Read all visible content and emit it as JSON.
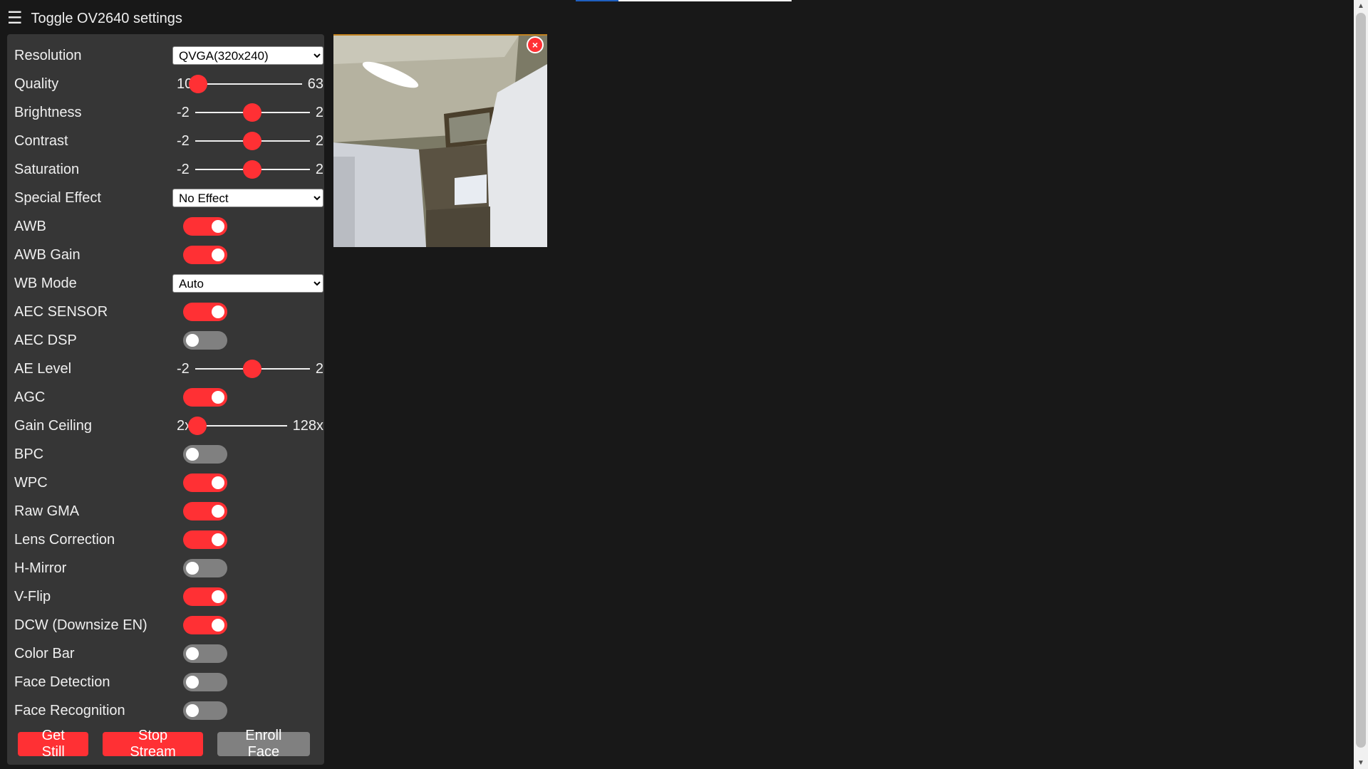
{
  "header": {
    "menu_icon": "☰",
    "title": "Toggle OV2640 settings"
  },
  "controls": {
    "resolution": {
      "label": "Resolution",
      "value": "QVGA(320x240)"
    },
    "quality": {
      "label": "Quality",
      "min": "10",
      "max": "63",
      "value": 10
    },
    "brightness": {
      "label": "Brightness",
      "min": "-2",
      "max": "2",
      "value": 0
    },
    "contrast": {
      "label": "Contrast",
      "min": "-2",
      "max": "2",
      "value": 0
    },
    "saturation": {
      "label": "Saturation",
      "min": "-2",
      "max": "2",
      "value": 0
    },
    "special_effect": {
      "label": "Special Effect",
      "value": "No Effect"
    },
    "awb": {
      "label": "AWB",
      "on": true
    },
    "awb_gain": {
      "label": "AWB Gain",
      "on": true
    },
    "wb_mode": {
      "label": "WB Mode",
      "value": "Auto"
    },
    "aec_sensor": {
      "label": "AEC SENSOR",
      "on": true
    },
    "aec_dsp": {
      "label": "AEC DSP",
      "on": false
    },
    "ae_level": {
      "label": "AE Level",
      "min": "-2",
      "max": "2",
      "value": 0
    },
    "agc": {
      "label": "AGC",
      "on": true
    },
    "gain_ceiling": {
      "label": "Gain Ceiling",
      "min": "2x",
      "max": "128x",
      "value_fraction": 0
    },
    "bpc": {
      "label": "BPC",
      "on": false
    },
    "wpc": {
      "label": "WPC",
      "on": true
    },
    "raw_gma": {
      "label": "Raw GMA",
      "on": true
    },
    "lens_correction": {
      "label": "Lens Correction",
      "on": true
    },
    "h_mirror": {
      "label": "H-Mirror",
      "on": false
    },
    "v_flip": {
      "label": "V-Flip",
      "on": true
    },
    "dcw": {
      "label": "DCW (Downsize EN)",
      "on": true
    },
    "color_bar": {
      "label": "Color Bar",
      "on": false
    },
    "face_detection": {
      "label": "Face Detection",
      "on": false
    },
    "face_recognition": {
      "label": "Face Recognition",
      "on": false
    }
  },
  "buttons": {
    "get_still": "Get Still",
    "stop_stream": "Stop Stream",
    "enroll_face": "Enroll Face"
  },
  "stream": {
    "close_label": "×"
  },
  "colors": {
    "accent": "#ff3034",
    "panel": "#363636",
    "background": "#181818",
    "toggle_off": "#808080"
  }
}
